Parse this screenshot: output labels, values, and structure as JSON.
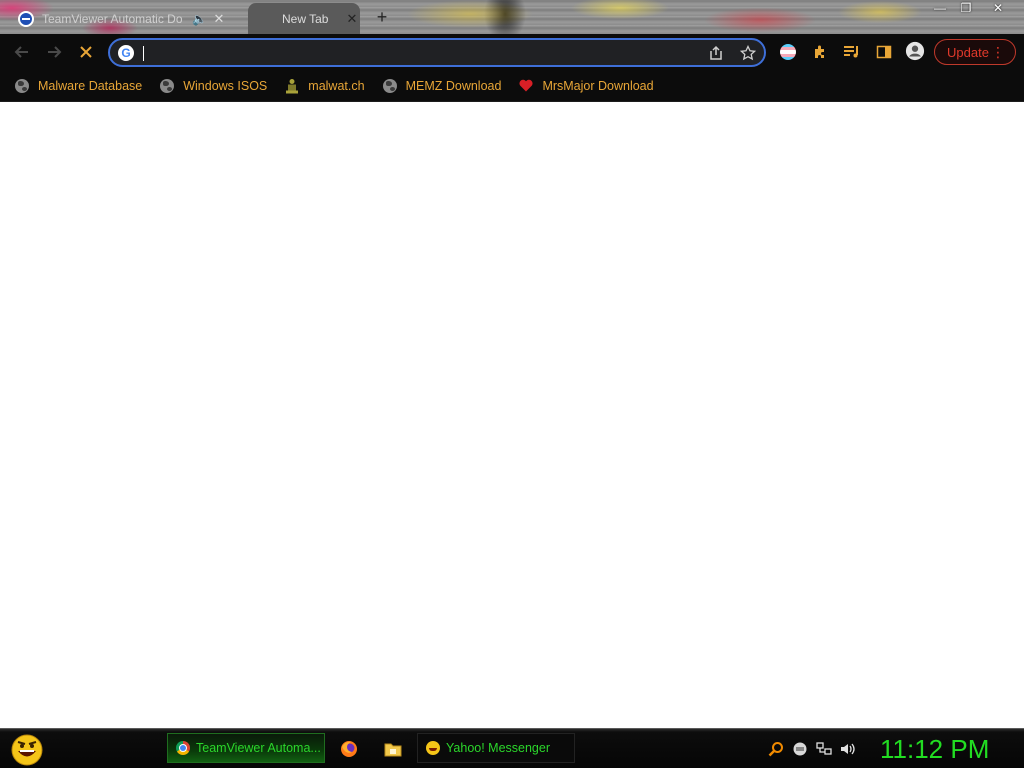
{
  "tabs": [
    {
      "title": "TeamViewer Automatic Dow",
      "active": false
    },
    {
      "title": "New Tab",
      "active": true
    }
  ],
  "window_controls": {
    "minimize": "—",
    "restore": "❐",
    "close": "✕"
  },
  "omnibox": {
    "value": "",
    "placeholder": ""
  },
  "toolbar": {
    "update_label": "Update"
  },
  "bookmarks": [
    {
      "label": "Malware Database",
      "icon": "globe-icon"
    },
    {
      "label": "Windows ISOS",
      "icon": "globe-icon"
    },
    {
      "label": "malwat.ch",
      "icon": "figure-icon"
    },
    {
      "label": "MEMZ Download",
      "icon": "globe-icon"
    },
    {
      "label": "MrsMajor Download",
      "icon": "heart-icon"
    }
  ],
  "taskbar": {
    "tasks": [
      {
        "label": "TeamViewer Automa...",
        "icon": "chrome-icon",
        "active": true
      },
      {
        "label": "Yahoo! Messenger",
        "icon": "smiley-icon",
        "active": false
      }
    ],
    "clock": "11:12 PM"
  },
  "colors": {
    "accent": "#3e6fd8",
    "bookmark_text": "#e8a637",
    "update": "#e0392b",
    "taskbar_text": "#2bd62b",
    "clock": "#22dd22"
  }
}
